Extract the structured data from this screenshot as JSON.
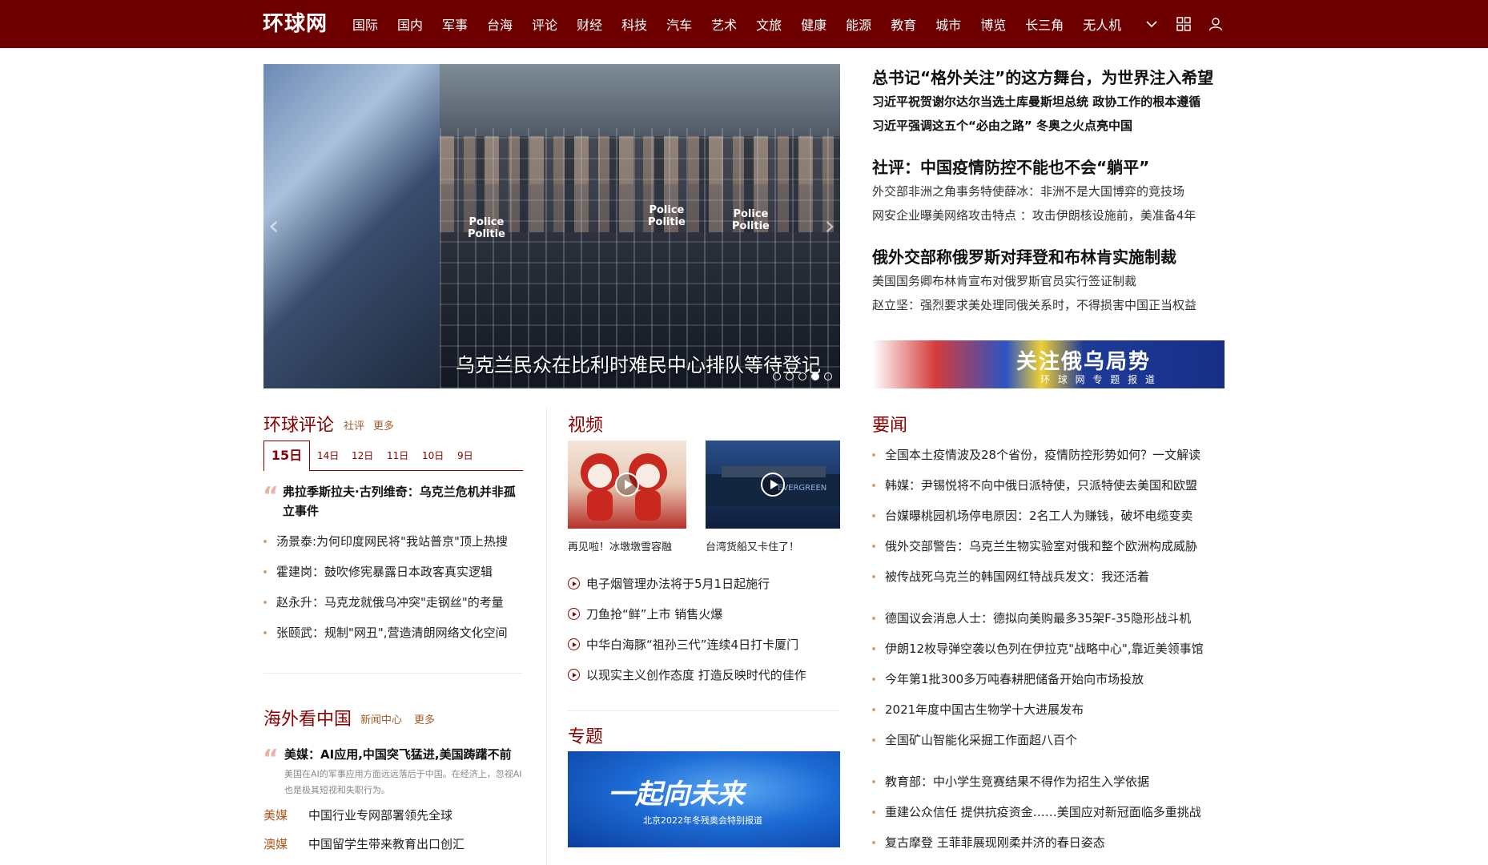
{
  "header": {
    "logo": "环球网",
    "nav": [
      "国际",
      "国内",
      "军事",
      "台海",
      "评论",
      "财经",
      "科技",
      "汽车",
      "艺术",
      "文旅",
      "健康",
      "能源",
      "教育",
      "城市",
      "博览",
      "长三角",
      "无人机"
    ]
  },
  "carousel": {
    "caption": "乌克兰民众在比利时难民中心排队等待登记",
    "police_labels": [
      "Police\nPolitie",
      "Police\nPolitie",
      "Police\nPolitie"
    ],
    "dot_count": 5,
    "active_dot": 4
  },
  "headlines": [
    {
      "title": "总书记“格外关注”的这方舞台，为世界注入希望",
      "subs": [
        "习近平祝贺谢尔达尔当选土库曼斯坦总统 政协工作的根本遵循",
        "习近平强调这五个“必由之路” 冬奥之火点亮中国"
      ],
      "subs_bold": true
    },
    {
      "title": "社评：中国疫情防控不能也不会“躺平”",
      "subs": [
        "外交部非洲之角事务特使薛冰：非洲不是大国博弈的竞技场",
        "网安企业曝美网络攻击特点 ：攻击伊朗核设施前，美准备4年"
      ],
      "subs_bold": false
    },
    {
      "title": "俄外交部称俄罗斯对拜登和布林肯实施制裁",
      "subs": [
        "美国国务卿布林肯宣布对俄罗斯官员实行签证制裁",
        "赵立坚：强烈要求美处理同俄关系时，不得损害中国正当权益"
      ],
      "subs_bold": false
    }
  ],
  "banner": {
    "title": "关注俄乌局势",
    "subtitle": "环 球 网 专 题 报 道"
  },
  "commentary": {
    "title": "环球评论",
    "links": [
      "社评",
      "更多"
    ],
    "active_day": "15日",
    "days": [
      "14日",
      "12日",
      "11日",
      "10日",
      "9日"
    ],
    "feature": "弗拉季斯拉夫·古列维奇：乌克兰危机并非孤立事件",
    "items": [
      "汤景泰:为何印度网民将\"我站普京\"顶上热搜",
      "霍建岗：鼓吹修宪暴露日本政客真实逻辑",
      "赵永升：马克龙就俄乌冲突\"走钢丝\"的考量",
      "张颐武：规制\"网丑\",营造清朗网络文化空间"
    ]
  },
  "overseas": {
    "title": "海外看中国",
    "links": [
      "新闻中心",
      "更多"
    ],
    "feature": "美媒：AI应用,中国突飞猛进,美国踌躇不前",
    "desc": "美国在AI的军事应用方面远远落后于中国。在经济上，忽视AI也是极其短视和失职行为。",
    "rows": [
      {
        "tag": "美媒",
        "text": "中国行业专网部署领先全球"
      },
      {
        "tag": "澳媒",
        "text": "中国留学生带来教育出口创汇"
      }
    ]
  },
  "video": {
    "title": "视频",
    "thumbs": [
      {
        "caption": "再见啦！冰墩墩雪容融"
      },
      {
        "caption": "台湾货船又卡住了！",
        "ship_text": "EVERGREEN"
      }
    ],
    "items": [
      "电子烟管理办法将于5月1日起施行",
      "刀鱼抢“鲜”上市 销售火爆",
      "中华白海豚“祖孙三代”连续4日打卡厦门",
      "以现实主义创作态度 打造反映时代的佳作"
    ]
  },
  "special": {
    "title": "专题",
    "banner_title": "一起向未来",
    "banner_sub": "北京2022年冬残奥会特别报道"
  },
  "news": {
    "title": "要闻",
    "groups": [
      [
        "全国本土疫情波及28个省份，疫情防控形势如何？一文解读",
        "韩媒：尹锡悦将不向中俄日派特使，只派特使去美国和欧盟",
        "台媒曝桃园机场停电原因：2名工人为赚钱，破坏电缆变卖",
        "俄外交部警告：乌克兰生物实验室对俄和整个欧洲构成威胁",
        "被传战死乌克兰的韩国网红特战兵发文：我还活着"
      ],
      [
        "德国议会消息人士：德拟向美购最多35架F-35隐形战斗机",
        "伊朗12枚导弹空袭以色列在伊拉克\"战略中心\",靠近美领事馆",
        "今年第1批300多万吨春耕肥储备开始向市场投放",
        "2021年度中国古生物学十大进展发布",
        "全国矿山智能化采掘工作面超八百个"
      ],
      [
        "教育部：中小学生竞赛结果不得作为招生入学依据",
        "重建公众信任 提供抗疫资金……美国应对新冠面临多重挑战",
        "复古摩登 王菲菲展现刚柔并济的春日姿态"
      ]
    ]
  },
  "colors": {
    "brand": "#6e0000",
    "accent": "#8a0000",
    "tag": "#b2561a"
  }
}
